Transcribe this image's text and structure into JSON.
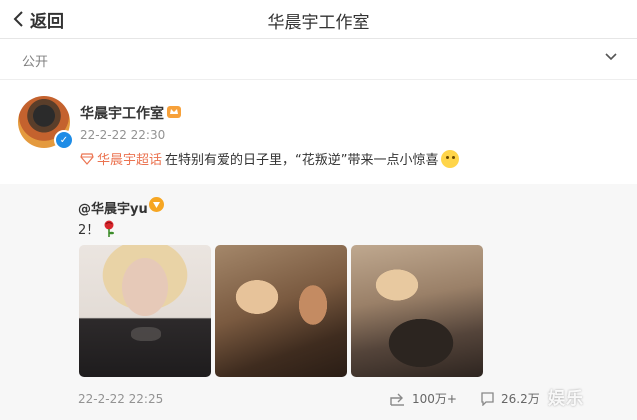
{
  "nav": {
    "back_label": "返回",
    "title": "华晨宇工作室"
  },
  "visibility": {
    "label": "公开"
  },
  "post": {
    "author": "华晨宇工作室",
    "time": "22-2-22 22:30",
    "topic": "华晨宇超话",
    "text": "在特别有爱的日子里，“花叛逆”带来一点小惊喜",
    "colors": {
      "topic": "#eb7350",
      "verified": "#1e8ce6"
    }
  },
  "repost": {
    "user": "@华晨宇yu",
    "text": "2！",
    "emoji": "rose-emoji",
    "photos": [
      "photo-1",
      "photo-2",
      "photo-3"
    ],
    "time": "22-2-22 22:25",
    "forward_count": "100万+",
    "comment_count": "26.2万"
  },
  "watermark": "娱乐"
}
